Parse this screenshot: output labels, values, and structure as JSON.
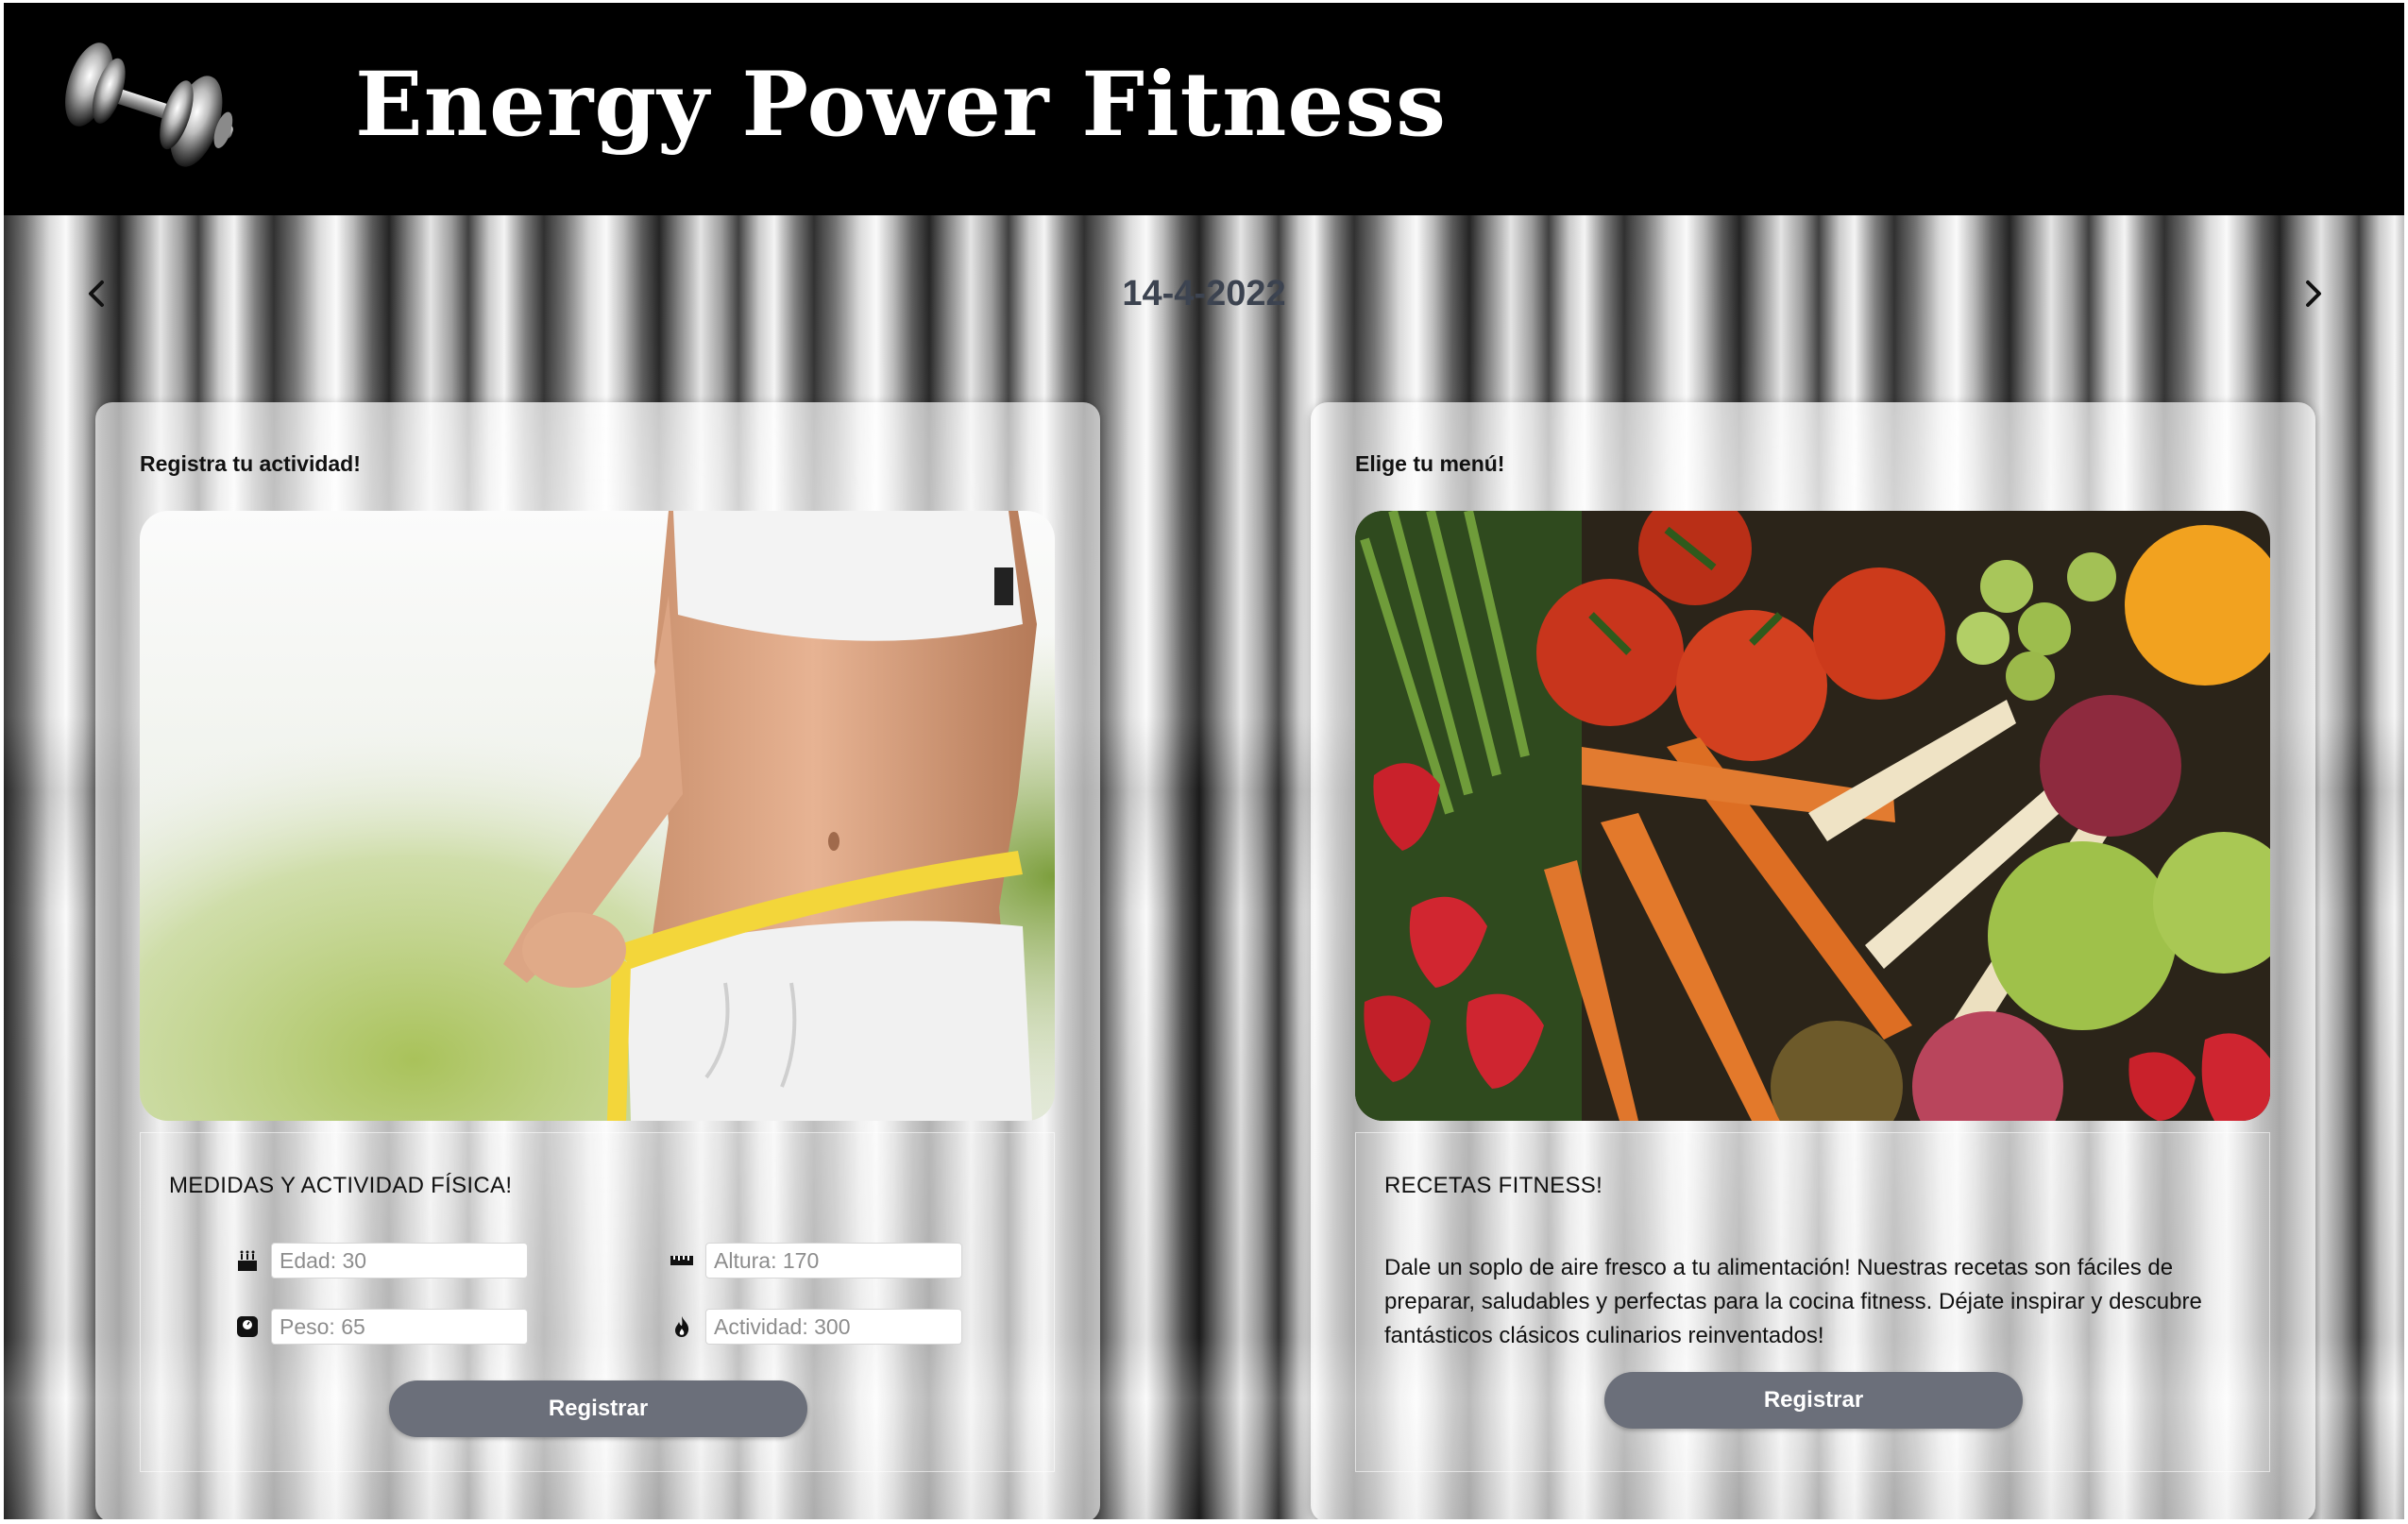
{
  "header": {
    "title": "Energy Power Fitness",
    "logo_icon": "dumbbell-icon",
    "background_color": "#000000"
  },
  "date_nav": {
    "date": "14-4-2022",
    "prev_icon": "chevron-left-icon",
    "next_icon": "chevron-right-icon"
  },
  "activity_card": {
    "heading": "Registra tu actividad!",
    "image_subject": "woman-measuring-waist",
    "section_title": "MEDIDAS Y ACTIVIDAD FÍSICA!",
    "fields": {
      "age": {
        "placeholder": "Edad: 30",
        "icon": "birthday-cake-icon"
      },
      "height": {
        "placeholder": "Altura: 170",
        "icon": "ruler-icon"
      },
      "weight": {
        "placeholder": "Peso: 65",
        "icon": "scale-icon"
      },
      "activity": {
        "placeholder": "Actividad: 300",
        "icon": "flame-icon"
      }
    },
    "button_label": "Registrar"
  },
  "menu_card": {
    "heading": "Elige tu menú!",
    "image_subject": "fresh-vegetables-and-fruit",
    "section_title": "RECETAS FITNESS!",
    "description": "Dale un soplo de aire fresco a tu alimentación! Nuestras recetas son fáciles de preparar, saludables y perfectas para la cocina fitness. Déjate inspirar y descubre fantásticos clásicos culinarios reinventados!",
    "button_label": "Registrar"
  },
  "colors": {
    "button": "#6b6f7a",
    "date_text": "#3c4350",
    "title_text": "#ffffff"
  }
}
